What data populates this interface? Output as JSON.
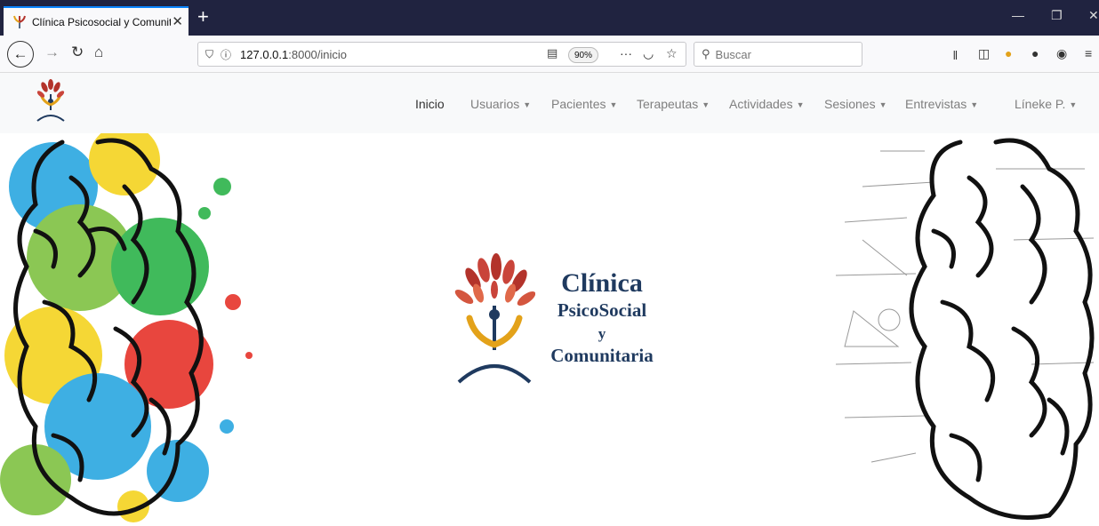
{
  "browser": {
    "tab_title": "Clínica Psicosocial y Comunitaria",
    "tab_close": "✕",
    "new_tab": "+",
    "url_host": "127.0.0.1",
    "url_rest": ":8000/inicio",
    "zoom": "90%",
    "search_placeholder": "Buscar",
    "page_actions": "···",
    "window_min": "—",
    "window_restore": "❐",
    "window_close": "✕"
  },
  "nav": {
    "items": [
      {
        "label": "Inicio",
        "dropdown": false,
        "active": true
      },
      {
        "label": "Usuarios",
        "dropdown": true
      },
      {
        "label": "Pacientes",
        "dropdown": true
      },
      {
        "label": "Terapeutas",
        "dropdown": true
      },
      {
        "label": "Actividades",
        "dropdown": true
      },
      {
        "label": "Sesiones",
        "dropdown": true
      },
      {
        "label": "Entrevistas",
        "dropdown": true
      }
    ],
    "user": "Líneke P."
  },
  "brand": {
    "line1": "Clínica",
    "line2": "PsicoSocial",
    "line3": "y",
    "line4": "Comunitaria"
  },
  "colors": {
    "brand_navy": "#1f3a5f",
    "brand_red": "#b3332b",
    "brand_orange": "#e3a21a",
    "titlebar": "#202340"
  },
  "icons": {
    "favicon": "tree-logo-icon",
    "back": "arrow-left-icon",
    "forward": "arrow-right-icon",
    "reload": "reload-icon",
    "home": "home-icon",
    "shield": "shield-icon",
    "info": "info-icon",
    "reader": "reader-view-icon",
    "pocket": "pocket-icon",
    "bookmark": "star-icon",
    "search": "search-icon",
    "library": "library-icon",
    "sidebar": "sidebar-icon",
    "menu": "hamburger-icon"
  }
}
